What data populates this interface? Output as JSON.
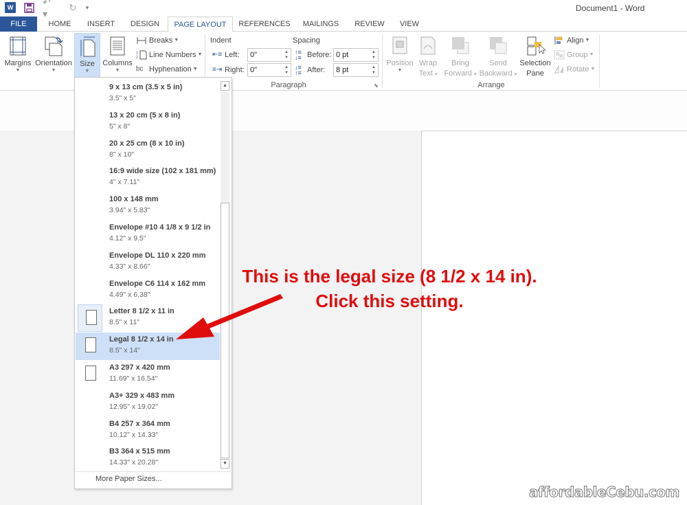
{
  "window": {
    "title": "Document1 - Word"
  },
  "quick_access": {
    "app_icon": "word-icon",
    "app_icon_text": "W",
    "save": "save-icon",
    "undo": "undo-icon",
    "undo_glyph": "↶ ▾",
    "redo": "redo-icon",
    "redo_glyph": "↻",
    "customize_glyph": "▾"
  },
  "tabs": [
    {
      "label": "FILE",
      "type": "file"
    },
    {
      "label": "HOME"
    },
    {
      "label": "INSERT"
    },
    {
      "label": "DESIGN"
    },
    {
      "label": "PAGE LAYOUT",
      "active": true
    },
    {
      "label": "REFERENCES"
    },
    {
      "label": "MAILINGS"
    },
    {
      "label": "REVIEW"
    },
    {
      "label": "VIEW"
    }
  ],
  "ribbon": {
    "page_setup": {
      "margins": "Margins",
      "orientation": "Orientation",
      "size": "Size",
      "columns": "Columns",
      "breaks": "Breaks",
      "line_numbers": "Line Numbers",
      "hyphenation": "Hyphenation",
      "hyphenation_icon_text": "bc"
    },
    "paragraph": {
      "group_label": "Paragraph",
      "indent_label": "Indent",
      "spacing_label": "Spacing",
      "left_label": "Left:",
      "left_value": "0\"",
      "right_label": "Right:",
      "right_value": "0\"",
      "before_label": "Before:",
      "before_value": "0 pt",
      "after_label": "After:",
      "after_value": "8 pt"
    },
    "arrange": {
      "group_label": "Arrange",
      "position": "Position",
      "wrap_text_1": "Wrap",
      "wrap_text_2": "Text",
      "bring_forward_1": "Bring",
      "bring_forward_2": "Forward",
      "send_backward_1": "Send",
      "send_backward_2": "Backward",
      "selection_pane_1": "Selection",
      "selection_pane_2": "Pane",
      "align": "Align",
      "group": "Group",
      "rotate": "Rotate"
    }
  },
  "size_dropdown": {
    "items": [
      {
        "name": "9 x 13 cm (3.5 x 5 in)",
        "dims": "3.5\" x 5\""
      },
      {
        "name": "13 x 20 cm (5 x 8 in)",
        "dims": "5\" x 8\""
      },
      {
        "name": "20 x 25 cm (8 x 10 in)",
        "dims": "8\" x 10\""
      },
      {
        "name": "16:9 wide size (102 x 181 mm)",
        "dims": "4\" x 7.11\""
      },
      {
        "name": "100 x 148 mm",
        "dims": "3.94\" x 5.83\""
      },
      {
        "name": "Envelope #10 4 1/8 x 9 1/2 in",
        "dims": "4.12\" x 9.5\""
      },
      {
        "name": "Envelope DL  110 x 220 mm",
        "dims": "4.33\" x 8.66\""
      },
      {
        "name": "Envelope C6  114 x 162 mm",
        "dims": "4.49\" x 6.38\""
      },
      {
        "name": "Letter 8 1/2 x 11 in",
        "dims": "8.5\" x 11\"",
        "thumb": true,
        "current": true
      },
      {
        "name": "Legal 8 1/2 x 14 in",
        "dims": "8.5\" x 14\"",
        "thumb": true,
        "hover": true
      },
      {
        "name": "A3 297 x 420 mm",
        "dims": "11.69\" x 16.54\"",
        "thumb": true
      },
      {
        "name": "A3+ 329 x 483 mm",
        "dims": "12.95\" x 19.02\""
      },
      {
        "name": "B4 257 x 364 mm",
        "dims": "10.12\" x 14.33\""
      },
      {
        "name": "B3 364 x 515 mm",
        "dims": "14.33\" x 20.28\""
      }
    ],
    "more_label": "More Paper Sizes...",
    "scroll_up_glyph": "▲",
    "scroll_down_glyph": "▼"
  },
  "annotation": {
    "line1": "This is the legal size (8 1/2 x 14 in).",
    "line2": "Click this setting.",
    "color": "#e00d0d"
  },
  "watermark": "affordableCebu.com"
}
